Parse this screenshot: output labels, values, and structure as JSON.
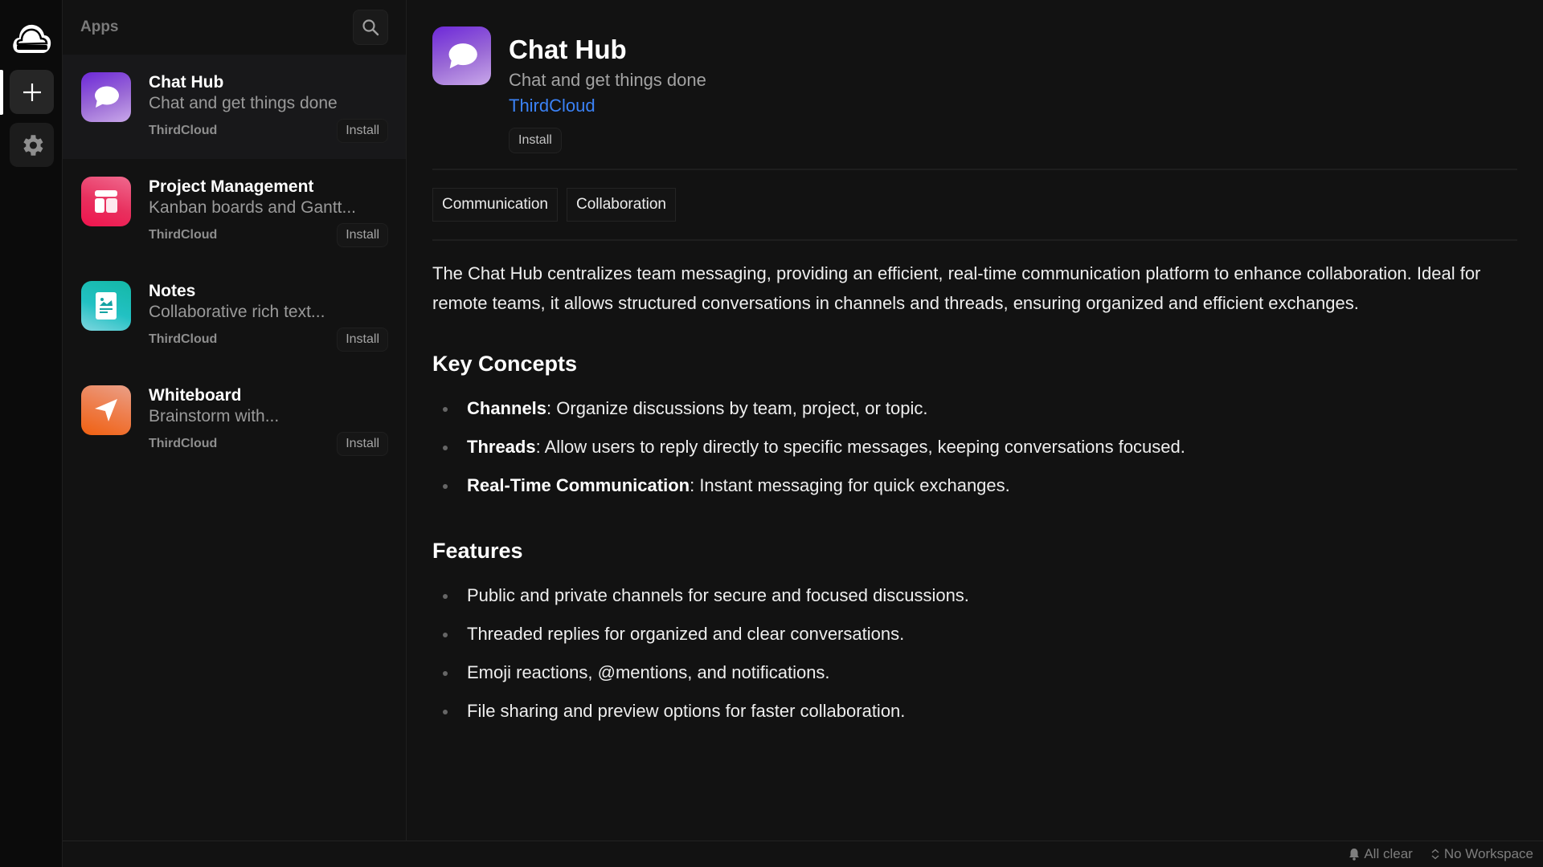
{
  "rail": {
    "logo_icon": "cloud-logo-icon",
    "add_icon": "plus-icon",
    "settings_icon": "gear-icon"
  },
  "sidebar": {
    "title": "Apps",
    "search_icon": "search-icon",
    "apps": [
      {
        "name": "Chat Hub",
        "description": "Chat and get things done",
        "vendor": "ThirdCloud",
        "install_label": "Install",
        "icon": "chat-bubble-icon",
        "colors": [
          "#6d28d9",
          "#c4a1e8"
        ],
        "selected": true
      },
      {
        "name": "Project Management",
        "description": "Kanban boards and Gantt...",
        "vendor": "ThirdCloud",
        "install_label": "Install",
        "icon": "grid-icon",
        "colors": [
          "#f0134d",
          "#f06a8f"
        ],
        "selected": false
      },
      {
        "name": "Notes",
        "description": "Collaborative rich text...",
        "vendor": "ThirdCloud",
        "install_label": "Install",
        "icon": "document-icon",
        "colors": [
          "#14b8a6",
          "#5fd0d8"
        ],
        "selected": false
      },
      {
        "name": "Whiteboard",
        "description": "Brainstorm with...",
        "vendor": "ThirdCloud",
        "install_label": "Install",
        "icon": "pointer-arrow-icon",
        "colors": [
          "#f06a1a",
          "#f09a7a"
        ],
        "selected": false
      }
    ]
  },
  "detail": {
    "title": "Chat Hub",
    "subtitle": "Chat and get things done",
    "vendor": "ThirdCloud",
    "install_label": "Install",
    "tags": [
      "Communication",
      "Collaboration"
    ],
    "description": "The Chat Hub centralizes team messaging, providing an efficient, real-time communication platform to enhance collaboration. Ideal for remote teams, it allows structured conversations in channels and threads, ensuring organized and efficient exchanges.",
    "key_concepts_heading": "Key Concepts",
    "key_concepts": [
      {
        "term": "Channels",
        "text": ": Organize discussions by team, project, or topic."
      },
      {
        "term": "Threads",
        "text": ": Allow users to reply directly to specific messages, keeping conversations focused."
      },
      {
        "term": "Real-Time Communication",
        "text": ": Instant messaging for quick exchanges."
      }
    ],
    "features_heading": "Features",
    "features": [
      "Public and private channels for secure and focused discussions.",
      "Threaded replies for organized and clear conversations.",
      "Emoji reactions, @mentions, and notifications.",
      "File sharing and preview options for faster collaboration."
    ]
  },
  "statusbar": {
    "notifications": "All clear",
    "workspace": "No Workspace"
  },
  "colors": {
    "accent_link": "#3b82f6",
    "background": "#121212"
  }
}
